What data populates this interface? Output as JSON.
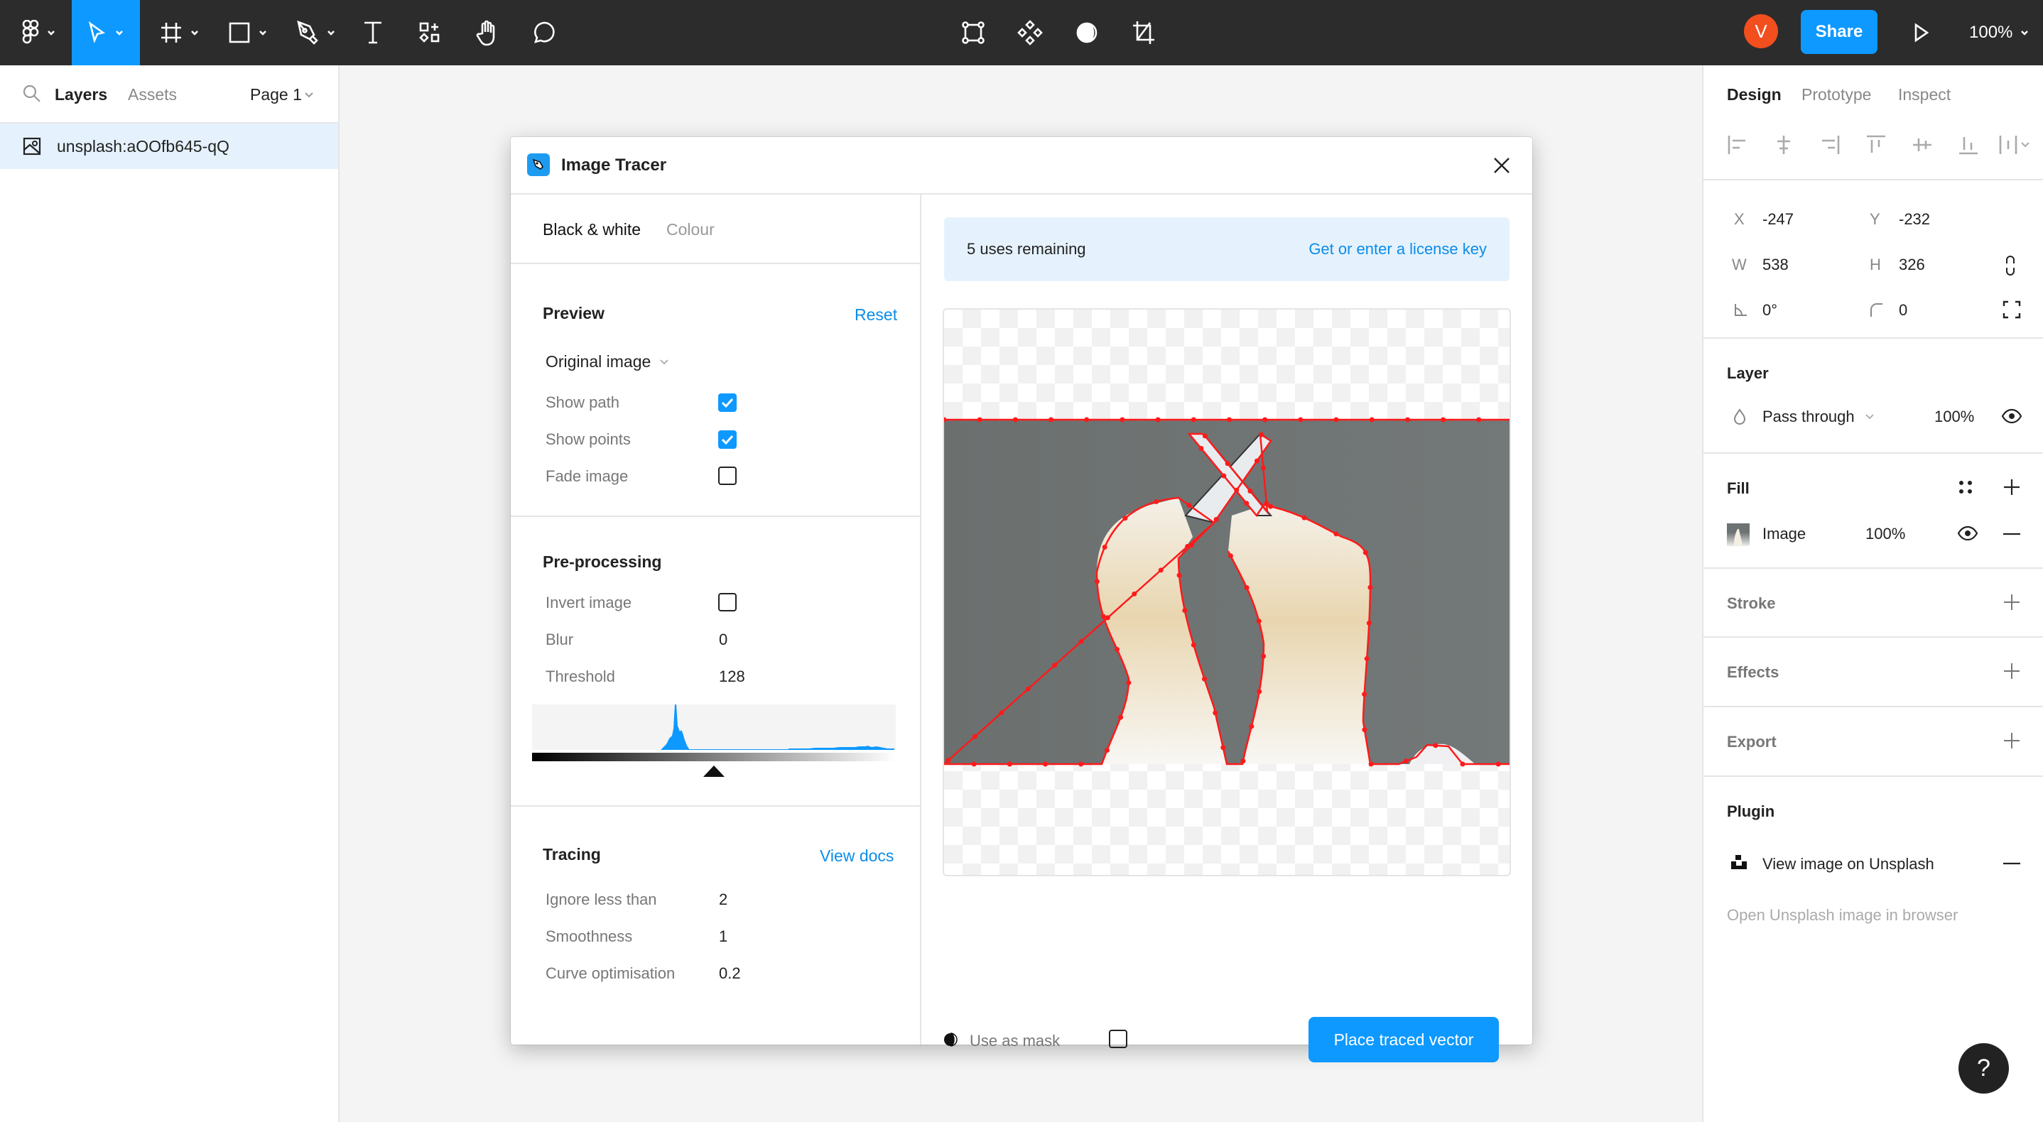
{
  "toolbar": {
    "tools": [
      "main-menu",
      "move",
      "frame",
      "shape",
      "pen",
      "text",
      "resources",
      "hand",
      "comment"
    ],
    "center_tools": [
      "edit-object",
      "component",
      "mask",
      "crop"
    ],
    "avatar_initial": "V",
    "share_label": "Share",
    "zoom_level": "100%",
    "colors": {
      "bg": "#2c2c2c",
      "accent": "#0d99ff",
      "avatar": "#f24e1e"
    }
  },
  "left_panel": {
    "tabs": [
      "Layers",
      "Assets"
    ],
    "active_tab": "Layers",
    "page_label": "Page 1",
    "layers": [
      {
        "name": "unsplash:aOOfb645-qQ",
        "type": "image",
        "selected": true
      }
    ]
  },
  "dialog": {
    "title": "Image Tracer",
    "mode_tabs": [
      "Black & white",
      "Colour"
    ],
    "active_mode": "Black & white",
    "preview": {
      "heading": "Preview",
      "reset_label": "Reset",
      "view_select": "Original image",
      "options": [
        {
          "label": "Show path",
          "checked": true
        },
        {
          "label": "Show points",
          "checked": true
        },
        {
          "label": "Fade image",
          "checked": false
        }
      ]
    },
    "preprocessing": {
      "heading": "Pre-processing",
      "invert_label": "Invert image",
      "invert_checked": false,
      "blur_label": "Blur",
      "blur_value": "0",
      "threshold_label": "Threshold",
      "threshold_value": "128",
      "threshold_fraction": 0.5
    },
    "tracing": {
      "heading": "Tracing",
      "docs_label": "View docs",
      "fields": [
        {
          "label": "Ignore less than",
          "value": "2"
        },
        {
          "label": "Smoothness",
          "value": "1"
        },
        {
          "label": "Curve optimisation",
          "value": "0.2"
        }
      ]
    },
    "license": {
      "uses_text": "5 uses remaining",
      "link_label": "Get or enter a license key"
    },
    "mask_label": "Use as mask",
    "mask_checked": false,
    "place_label": "Place traced vector",
    "trace_color": "#ff1a1a"
  },
  "right_panel": {
    "tabs": [
      "Design",
      "Prototype",
      "Inspect"
    ],
    "active_tab": "Design",
    "x_label": "X",
    "x_value": "-247",
    "y_label": "Y",
    "y_value": "-232",
    "w_label": "W",
    "w_value": "538",
    "h_label": "H",
    "h_value": "326",
    "rotation_value": "0°",
    "radius_value": "0",
    "layer": {
      "heading": "Layer",
      "blend_mode": "Pass through",
      "opacity": "100%"
    },
    "fill": {
      "heading": "Fill",
      "type": "Image",
      "opacity": "100%"
    },
    "stroke_heading": "Stroke",
    "effects_heading": "Effects",
    "export_heading": "Export",
    "plugin": {
      "heading": "Plugin",
      "item_label": "View image on Unsplash",
      "hint": "Open Unsplash image in browser"
    }
  },
  "help_label": "?"
}
